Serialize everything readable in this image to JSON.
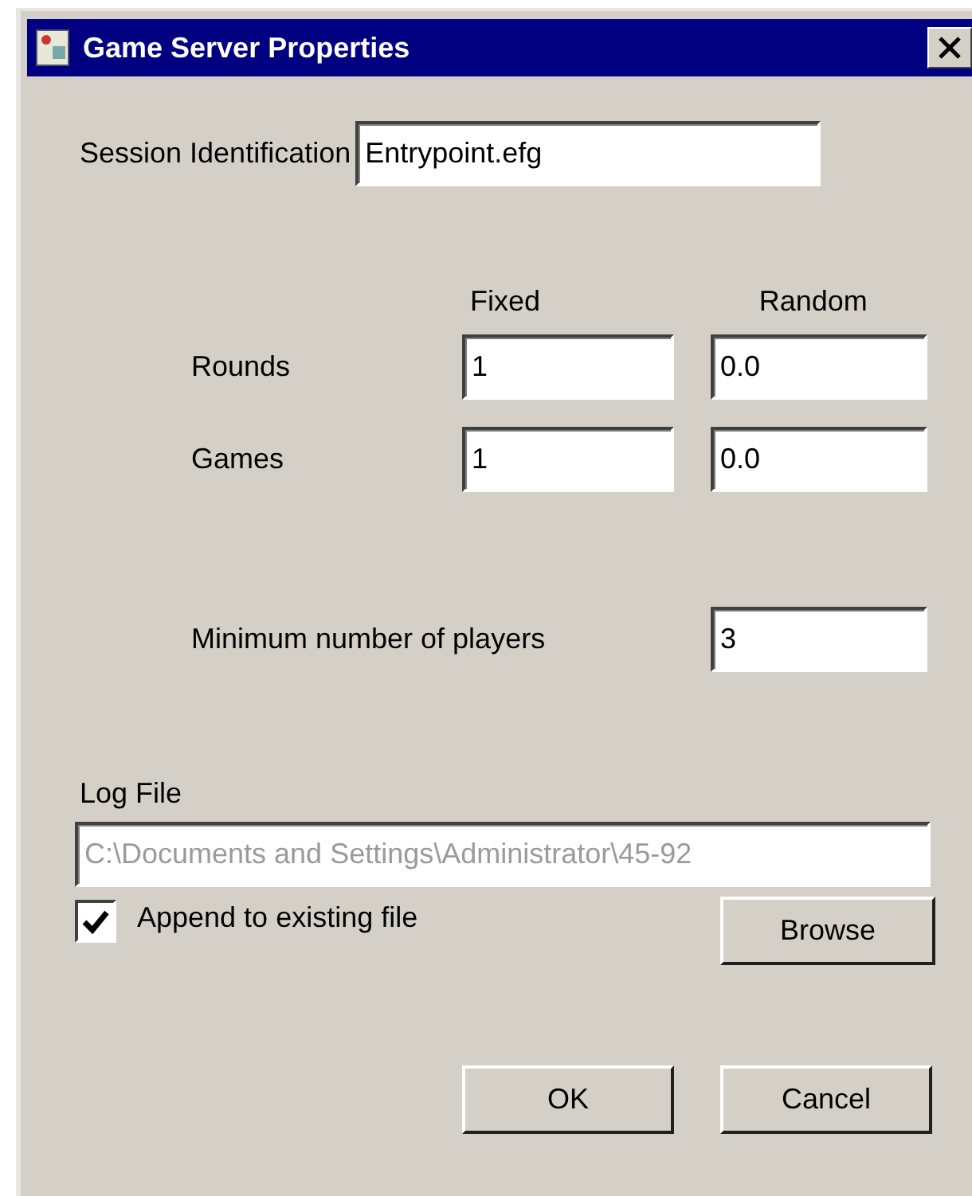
{
  "window": {
    "title": "Game Server Properties"
  },
  "session": {
    "label": "Session Identification",
    "value": "Entrypoint.efg"
  },
  "columns": [
    "Fixed",
    "Random"
  ],
  "rows": [
    {
      "label": "Rounds",
      "fixed": "1",
      "random": "0.0"
    },
    {
      "label": "Games",
      "fixed": "1",
      "random": "0.0"
    }
  ],
  "min_players": {
    "label": "Minimum number of players",
    "value": "3"
  },
  "log_file": {
    "label": "Log File",
    "value": "C:\\Documents and Settings\\Administrator\\45-92",
    "disabled": true
  },
  "append": {
    "label": "Append to existing file",
    "checked": true
  },
  "browse_button": "Browse",
  "buttons": [
    "OK",
    "Cancel"
  ]
}
